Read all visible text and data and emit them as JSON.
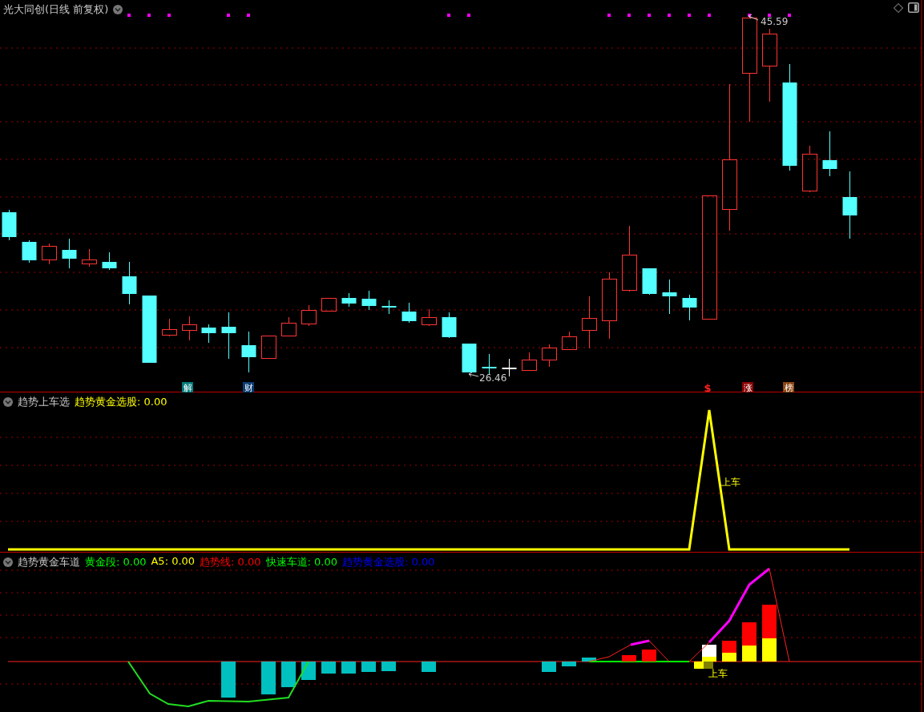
{
  "price_panel": {
    "title": "光大同创(日线 前复权)",
    "high_label": "45.59",
    "low_label": "26.46",
    "events": [
      {
        "label": "解",
        "kind": "badge",
        "color": "#007b7b"
      },
      {
        "label": "财",
        "kind": "badge",
        "color": "#0a3d73"
      },
      {
        "label": "$",
        "kind": "glyph",
        "color": "#ff2020"
      },
      {
        "label": "涨",
        "kind": "badge",
        "color": "#8b0000"
      },
      {
        "label": "榜",
        "kind": "badge",
        "color": "#8b4513"
      }
    ]
  },
  "signal_panel": {
    "title": "趋势上车选",
    "legend": [
      {
        "text": "趋势黄金选股: 0.00",
        "color": "#ffff00"
      }
    ],
    "signal_label": "上车"
  },
  "lane_panel": {
    "title": "趋势黄金车道",
    "legend": [
      {
        "text": "黄金段: 0.00",
        "color": "#00ff00"
      },
      {
        "text": "A5: 0.00",
        "color": "#ffff00"
      },
      {
        "text": "趋势线: 0.00",
        "color": "#ff0000"
      },
      {
        "text": "快速车道: 0.00",
        "color": "#00ff00"
      },
      {
        "text": "趋势黄金选股: 0.00",
        "color": "#0000ff"
      }
    ],
    "signal_label": "上车"
  }
}
